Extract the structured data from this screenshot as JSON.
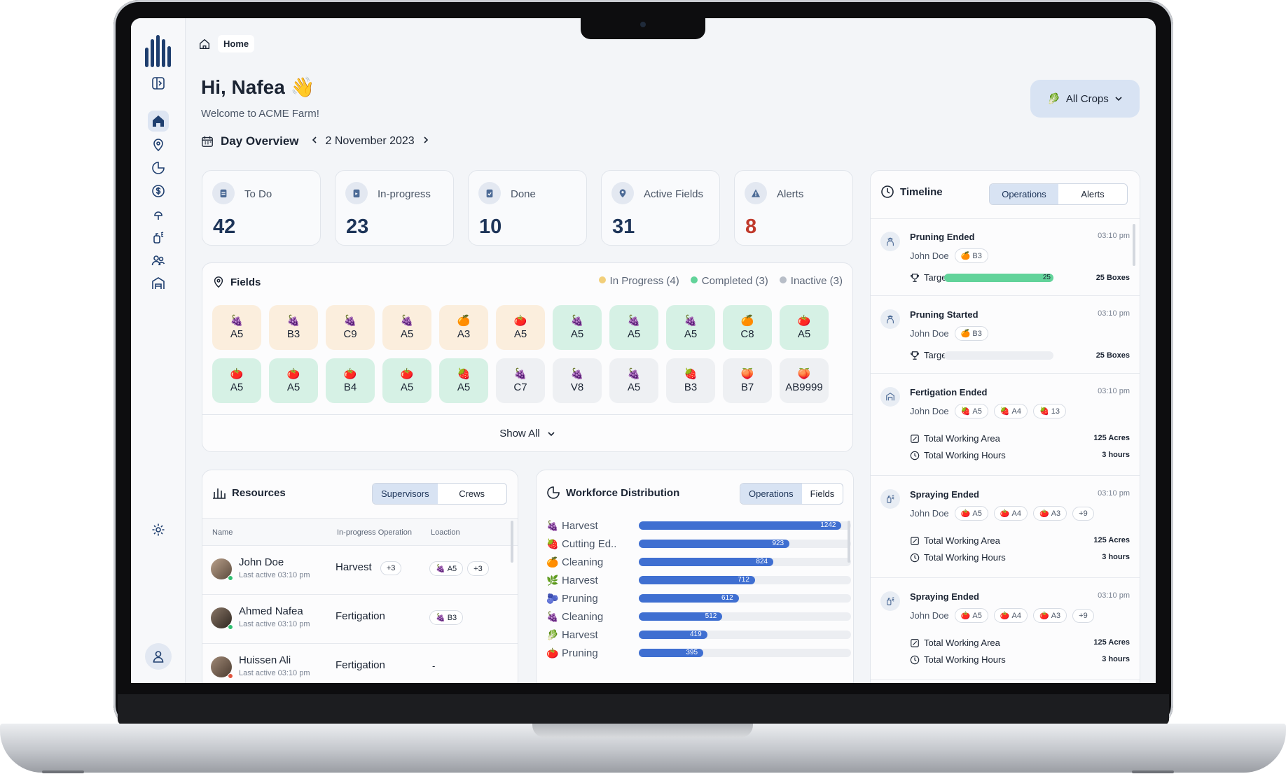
{
  "breadcrumb": {
    "label": "Home"
  },
  "header": {
    "greeting": "Hi, Nafea",
    "wave": "👋",
    "welcome": "Welcome to ACME Farm!",
    "day_overview": "Day Overview",
    "date": "2 November 2023",
    "crops_filter": "All Crops"
  },
  "stats": [
    {
      "label": "To Do",
      "value": "42",
      "icon": "clipboard-icon"
    },
    {
      "label": "In-progress",
      "value": "23",
      "icon": "clipboard-progress-icon"
    },
    {
      "label": "Done",
      "value": "10",
      "icon": "clipboard-check-icon"
    },
    {
      "label": "Active Fields",
      "value": "31",
      "icon": "location-pin-icon"
    },
    {
      "label": "Alerts",
      "value": "8",
      "icon": "warning-icon"
    }
  ],
  "fields": {
    "title": "Fields",
    "legend": [
      {
        "label": "In Progress (4)",
        "color": "#f2cf7a"
      },
      {
        "label": "Completed (3)",
        "color": "#62d39a"
      },
      {
        "label": "Inactive (3)",
        "color": "#b8bec8"
      }
    ],
    "tiles": [
      {
        "code": "A5",
        "fruit": "🍇",
        "status": "prog"
      },
      {
        "code": "B3",
        "fruit": "🍇",
        "status": "prog"
      },
      {
        "code": "C9",
        "fruit": "🍇",
        "status": "prog"
      },
      {
        "code": "A5",
        "fruit": "🍇",
        "status": "prog"
      },
      {
        "code": "A3",
        "fruit": "🍊",
        "status": "prog"
      },
      {
        "code": "A5",
        "fruit": "🍅",
        "status": "prog"
      },
      {
        "code": "A5",
        "fruit": "🍇",
        "status": "done"
      },
      {
        "code": "A5",
        "fruit": "🍇",
        "status": "done"
      },
      {
        "code": "A5",
        "fruit": "🍇",
        "status": "done"
      },
      {
        "code": "C8",
        "fruit": "🍊",
        "status": "done"
      },
      {
        "code": "A5",
        "fruit": "🍅",
        "status": "done"
      },
      {
        "code": "A5",
        "fruit": "🍅",
        "status": "done"
      },
      {
        "code": "A5",
        "fruit": "🍅",
        "status": "done"
      },
      {
        "code": "B4",
        "fruit": "🍅",
        "status": "done"
      },
      {
        "code": "A5",
        "fruit": "🍅",
        "status": "done"
      },
      {
        "code": "A5",
        "fruit": "🍓",
        "status": "done"
      },
      {
        "code": "C7",
        "fruit": "🍇",
        "status": "inact"
      },
      {
        "code": "V8",
        "fruit": "🍇",
        "status": "inact"
      },
      {
        "code": "A5",
        "fruit": "🍇",
        "status": "inact"
      },
      {
        "code": "B3",
        "fruit": "🍓",
        "status": "inact"
      },
      {
        "code": "B7",
        "fruit": "🍑",
        "status": "inact"
      },
      {
        "code": "AB9999",
        "fruit": "🍑",
        "status": "inact"
      }
    ],
    "show_all": "Show All"
  },
  "resources": {
    "title": "Resources",
    "tabs": [
      "Supervisors",
      "Crews"
    ],
    "columns": [
      "Name",
      "In-progress Operation",
      "Loaction"
    ],
    "rows": [
      {
        "name": "John Doe",
        "last": "Last active 03:10 pm",
        "op": "Harvest",
        "op_more": "+3",
        "loc": "A5",
        "loc_more": "+3",
        "status": "#2fbf71"
      },
      {
        "name": "Ahmed Nafea",
        "last": "Last active 03:10 pm",
        "op": "Fertigation",
        "op_more": "",
        "loc": "B3",
        "loc_more": "",
        "status": "#2fbf71"
      },
      {
        "name": "Huissen Ali",
        "last": "Last active 03:10 pm",
        "op": "Fertigation",
        "op_more": "",
        "loc": "-",
        "loc_more": "",
        "status": "#e0533d"
      }
    ]
  },
  "workforce": {
    "title": "Workforce Distribution",
    "tabs": [
      "Operations",
      "Fields"
    ],
    "max": 1300,
    "rows": [
      {
        "label": "Harvest",
        "value": 1242,
        "icon": "🍇"
      },
      {
        "label": "Cutting Ed..",
        "value": 923,
        "icon": "🍓"
      },
      {
        "label": "Cleaning",
        "value": 824,
        "icon": "🍊"
      },
      {
        "label": "Harvest",
        "value": 712,
        "icon": "🌿"
      },
      {
        "label": "Pruning",
        "value": 612,
        "icon": "🫐"
      },
      {
        "label": "Cleaning",
        "value": 512,
        "icon": "🍇"
      },
      {
        "label": "Harvest",
        "value": 419,
        "icon": "🥬"
      },
      {
        "label": "Pruning",
        "value": 395,
        "icon": "🍅"
      }
    ]
  },
  "timeline": {
    "title": "Timeline",
    "tabs": [
      "Operations",
      "Alerts"
    ],
    "items": [
      {
        "title": "Pruning Ended",
        "time": "03:10 pm",
        "who": "John Doe",
        "tags": [
          "B3"
        ],
        "target_label": "Target",
        "target_val": "25",
        "target_unit": "25 Boxes",
        "target_fill": 1.0
      },
      {
        "title": "Pruning Started",
        "time": "03:10 pm",
        "who": "John Doe",
        "tags": [
          "B3"
        ],
        "target_label": "Target",
        "target_val": "",
        "target_unit": "25 Boxes",
        "target_fill": 0
      },
      {
        "title": "Fertigation Ended",
        "time": "03:10 pm",
        "who": "John Doe",
        "tags": [
          "A5",
          "A4",
          "13"
        ],
        "area_label": "Total Working Area",
        "area": "125 Acres",
        "hours_label": "Total Working Hours",
        "hours": "3 hours"
      },
      {
        "title": "Spraying Ended",
        "time": "03:10 pm",
        "who": "John Doe",
        "tags": [
          "A5",
          "A4",
          "A3",
          "+9"
        ],
        "area_label": "Total Working Area",
        "area": "125 Acres",
        "hours_label": "Total Working Hours",
        "hours": "3 hours"
      },
      {
        "title": "Spraying Ended",
        "time": "03:10 pm",
        "who": "John Doe",
        "tags": [
          "A5",
          "A4",
          "A3",
          "+9"
        ],
        "area_label": "Total Working Area",
        "area": "125 Acres",
        "hours_label": "Total Working Hours",
        "hours": "3 hours"
      }
    ]
  }
}
